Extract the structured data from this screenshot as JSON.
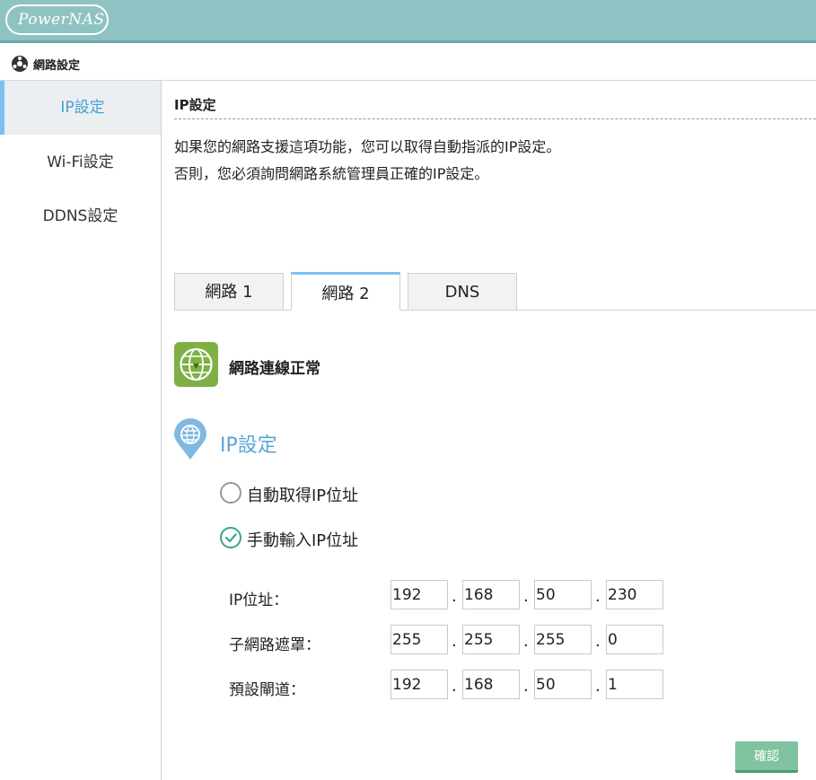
{
  "app": {
    "logo_text": "PowerNAS"
  },
  "titlebar": {
    "icon": "network-icon",
    "title": "網路設定"
  },
  "sidebar": {
    "items": [
      {
        "label": "IP設定",
        "active": true
      },
      {
        "label": "Wi-Fi設定",
        "active": false
      },
      {
        "label": "DDNS設定",
        "active": false
      }
    ]
  },
  "main": {
    "title": "IP設定",
    "description_line1": "如果您的網路支援這項功能，您可以取得自動指派的IP設定。",
    "description_line2": "否則，您必須詢問網路系統管理員正確的IP設定。",
    "tabs": [
      {
        "label": "網路 1",
        "active": false
      },
      {
        "label": "網路 2",
        "active": true
      },
      {
        "label": "DNS",
        "active": false
      }
    ],
    "status_icon": "globe-icon",
    "status_text": "網路連線正常",
    "ip_section_icon": "location-pin-icon",
    "ip_section_title": "IP設定",
    "options": [
      {
        "label": "自動取得IP位址",
        "checked": false
      },
      {
        "label": "手動輸入IP位址",
        "checked": true
      }
    ],
    "fields": {
      "ip": {
        "label": "IP位址：",
        "octets": [
          "192",
          "168",
          "50",
          "230"
        ]
      },
      "subnet": {
        "label": "子網路遮罩：",
        "octets": [
          "255",
          "255",
          "255",
          "0"
        ]
      },
      "gateway": {
        "label": "預設閘道：",
        "octets": [
          "192",
          "168",
          "50",
          "1"
        ]
      }
    },
    "separator": ".",
    "confirm_label": "確認"
  },
  "colors": {
    "topbar": "#8fc3c3",
    "accent_blue": "#5aa6d8",
    "status_green": "#7fb045",
    "confirm_green": "#7fc3a0",
    "radio_check": "#3aa58a"
  }
}
